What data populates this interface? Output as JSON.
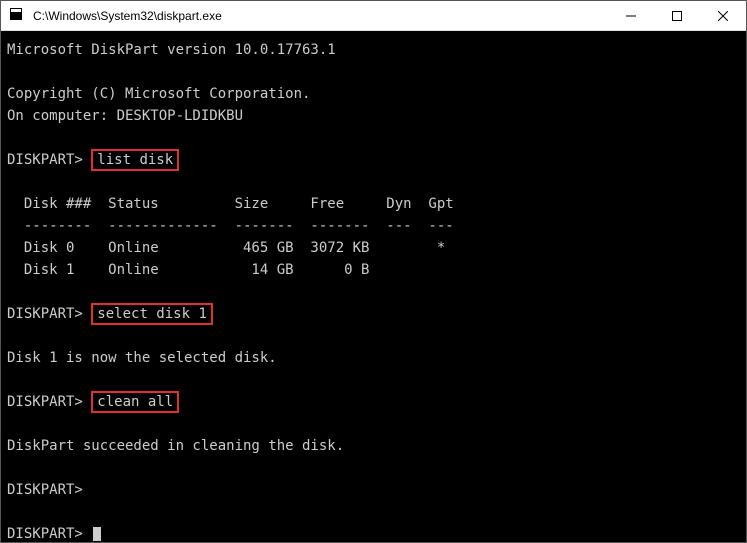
{
  "window": {
    "title": "C:\\Windows\\System32\\diskpart.exe"
  },
  "term": {
    "version_line": "Microsoft DiskPart version 10.0.17763.1",
    "copyright_line": "Copyright (C) Microsoft Corporation.",
    "computer_line": "On computer: DESKTOP-LDIDKBU",
    "prompt": "DISKPART>",
    "cmd1": "list disk",
    "table_header": "  Disk ###  Status         Size     Free     Dyn  Gpt",
    "table_divider": "  --------  -------------  -------  -------  ---  ---",
    "table_rows": [
      "  Disk 0    Online          465 GB  3072 KB        *",
      "  Disk 1    Online           14 GB      0 B"
    ],
    "cmd2": "select disk 1",
    "select_msg": "Disk 1 is now the selected disk.",
    "cmd3": "clean all",
    "clean_msg": "DiskPart succeeded in cleaning the disk."
  },
  "chart_data": {
    "type": "table",
    "title": "DiskPart list disk",
    "columns": [
      "Disk ###",
      "Status",
      "Size",
      "Free",
      "Dyn",
      "Gpt"
    ],
    "rows": [
      {
        "Disk ###": "Disk 0",
        "Status": "Online",
        "Size": "465 GB",
        "Free": "3072 KB",
        "Dyn": "",
        "Gpt": "*"
      },
      {
        "Disk ###": "Disk 1",
        "Status": "Online",
        "Size": "14 GB",
        "Free": "0 B",
        "Dyn": "",
        "Gpt": ""
      }
    ]
  }
}
